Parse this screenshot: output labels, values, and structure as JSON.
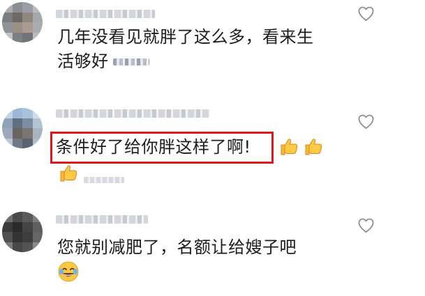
{
  "comments": [
    {
      "text_line1": "几年没看见就胖了这么多，看来生",
      "text_line2": "活够好",
      "like_icon": "heart-outline-icon"
    },
    {
      "text": "条件好了给你胖这样了啊!",
      "highlight_color": "#e21818",
      "emoji": "thumbs-up-icon",
      "like_icon": "heart-outline-icon"
    },
    {
      "text": "您就别减肥了，名额让给嫂子吧",
      "emoji": "crying-laughing-face-icon",
      "like_icon": "heart-outline-icon"
    }
  ]
}
